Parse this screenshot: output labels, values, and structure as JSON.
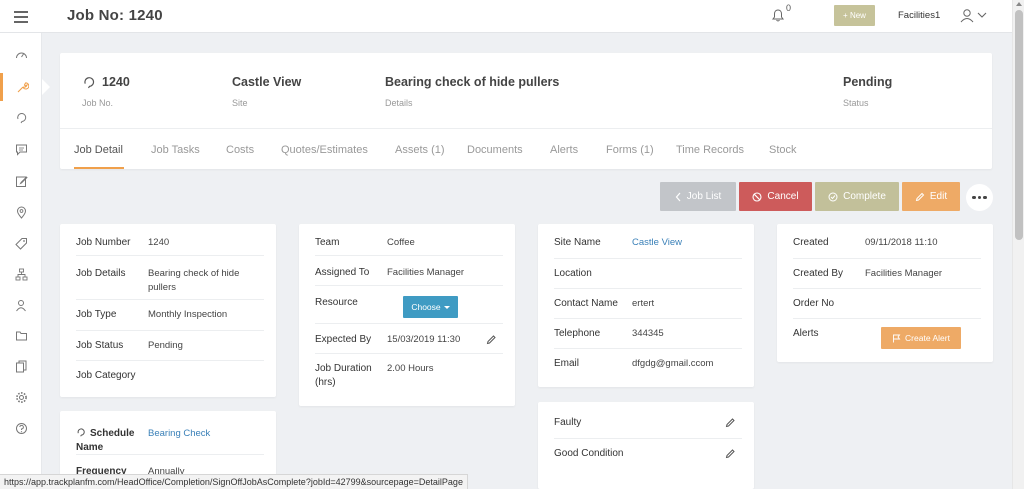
{
  "header": {
    "title": "Job No: 1240",
    "notification_count": "0",
    "new_button": "+ New",
    "user_name": "Facilities1"
  },
  "job": {
    "number": "1240",
    "number_label": "Job No.",
    "site": "Castle View",
    "site_label": "Site",
    "details": "Bearing check of hide pullers",
    "details_label": "Details",
    "status": "Pending",
    "status_label": "Status"
  },
  "tabs": [
    {
      "label": "Job Detail",
      "active": true
    },
    {
      "label": "Job Tasks"
    },
    {
      "label": "Costs"
    },
    {
      "label": "Quotes/Estimates"
    },
    {
      "label": "Assets (1)"
    },
    {
      "label": "Documents"
    },
    {
      "label": "Alerts"
    },
    {
      "label": "Forms (1)"
    },
    {
      "label": "Time Records"
    },
    {
      "label": "Stock"
    }
  ],
  "actions": {
    "job_list": "Job List",
    "cancel": "Cancel",
    "complete": "Complete",
    "edit": "Edit"
  },
  "job_info": {
    "rows": [
      {
        "label": "Job Number",
        "value": "1240"
      },
      {
        "label": "Job Details",
        "value": "Bearing check of hide pullers"
      },
      {
        "label": "Job Type",
        "value": "Monthly Inspection"
      },
      {
        "label": "Job Status",
        "value": "Pending"
      },
      {
        "label": "Job Category",
        "value": ""
      }
    ]
  },
  "schedule": {
    "name_label": "Schedule Name",
    "name_value": "Bearing Check",
    "frequency_label": "Frequency",
    "frequency_value": "Annually"
  },
  "assignment": {
    "team_label": "Team",
    "team_value": "Coffee",
    "assigned_label": "Assigned To",
    "assigned_value": "Facilities Manager",
    "resource_label": "Resource",
    "resource_button": "Choose",
    "expected_label": "Expected By",
    "expected_value": "15/03/2019 11:30",
    "duration_label": "Job Duration (hrs)",
    "duration_value": "2.00 Hours"
  },
  "site_info": {
    "rows": [
      {
        "label": "Site Name",
        "value": "Castle View"
      },
      {
        "label": "Location",
        "value": ""
      },
      {
        "label": "Contact Name",
        "value": "ertert"
      },
      {
        "label": "Telephone",
        "value": "344345"
      },
      {
        "label": "Email",
        "value": "dfgdg@gmail.ccom"
      }
    ]
  },
  "condition": {
    "faulty": "Faulty",
    "good": "Good Condition"
  },
  "meta_info": {
    "created_label": "Created",
    "created_value": "09/11/2018 11:10",
    "created_by_label": "Created By",
    "created_by_value": "Facilities Manager",
    "order_label": "Order No",
    "order_value": "",
    "alerts_label": "Alerts",
    "alert_button": "Create Alert"
  },
  "status_url": "https://app.trackplanfm.com/HeadOffice/Completion/SignOffJobAsComplete?jobId=42799&sourcepage=DetailPage",
  "colors": {
    "accent": "#f0a04b",
    "cancel": "#cd5b5b",
    "complete": "#c2c09a",
    "choose": "#3f9bc3",
    "link": "#3a80b8"
  }
}
